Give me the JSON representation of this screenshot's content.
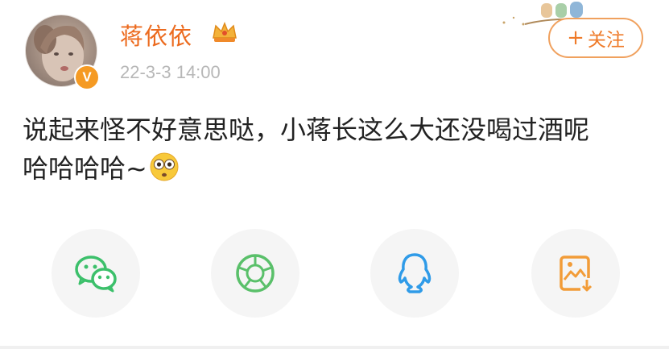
{
  "post": {
    "username": "蒋依依",
    "timestamp": "22-3-3 14:00",
    "verified_badge": "V",
    "follow_label": "关注",
    "follow_plus": "+",
    "text_line1": "说起来怪不好意思哒，小蒋长这么大还没喝过酒呢",
    "text_line2": "哈哈哈哈~"
  },
  "icons": {
    "crown": "crown-icon",
    "emoji": "wide-eyed-emoji-icon",
    "share": [
      "wechat-icon",
      "moments-icon",
      "qq-icon",
      "save-image-icon"
    ]
  },
  "colors": {
    "accent": "#ec6b1f",
    "follow_border": "#f0a15e",
    "wechat": "#3cc06b",
    "qq": "#2f9be8",
    "save": "#f29c38",
    "timestamp": "#b7b7b7"
  }
}
